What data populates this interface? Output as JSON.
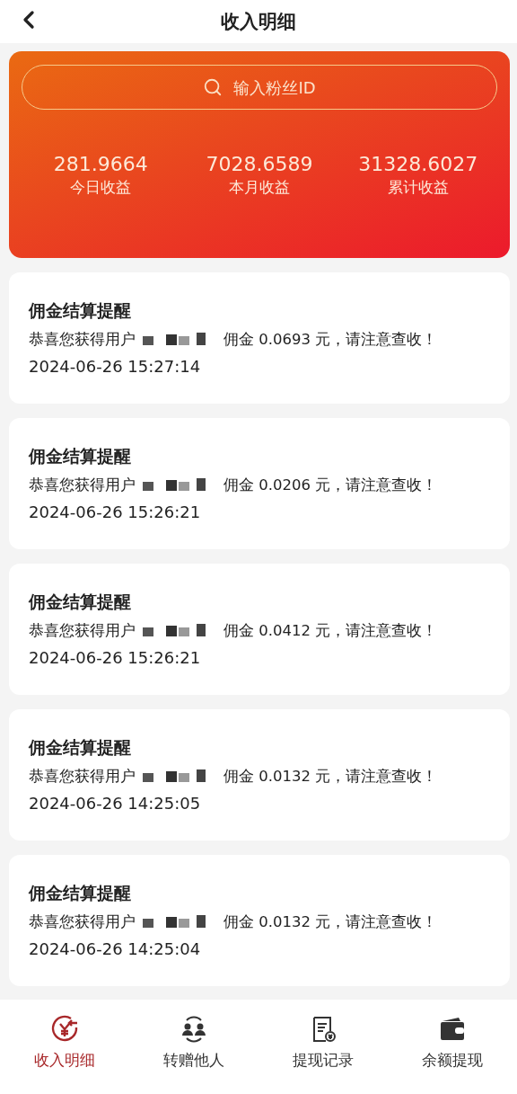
{
  "header": {
    "title": "收入明细"
  },
  "summary": {
    "search": {
      "placeholder": "输入粉丝ID"
    },
    "stats": [
      {
        "value": "281.9664",
        "label": "今日收益"
      },
      {
        "value": "7028.6589",
        "label": "本月收益"
      },
      {
        "value": "31328.6027",
        "label": "累计收益"
      }
    ]
  },
  "notices": [
    {
      "title": "佣金结算提醒",
      "message_prefix": "恭喜您获得用户",
      "message_suffix": "佣金 0.0693 元，请注意查收！",
      "time": "2024-06-26 15:27:14"
    },
    {
      "title": "佣金结算提醒",
      "message_prefix": "恭喜您获得用户",
      "message_suffix": "佣金 0.0206 元，请注意查收！",
      "time": "2024-06-26 15:26:21"
    },
    {
      "title": "佣金结算提醒",
      "message_prefix": "恭喜您获得用户",
      "message_suffix": "佣金 0.0412 元，请注意查收！",
      "time": "2024-06-26 15:26:21"
    },
    {
      "title": "佣金结算提醒",
      "message_prefix": "恭喜您获得用户",
      "message_suffix": "佣金 0.0132 元，请注意查收！",
      "time": "2024-06-26 14:25:05"
    },
    {
      "title": "佣金结算提醒",
      "message_prefix": "恭喜您获得用户",
      "message_suffix": "佣金 0.0132 元，请注意查收！",
      "time": "2024-06-26 14:25:04"
    }
  ],
  "tab_bar": [
    {
      "label": "收入明细",
      "selected": true
    },
    {
      "label": "转赠他人",
      "selected": false
    },
    {
      "label": "提现记录",
      "selected": false
    },
    {
      "label": "余额提现",
      "selected": false
    }
  ]
}
